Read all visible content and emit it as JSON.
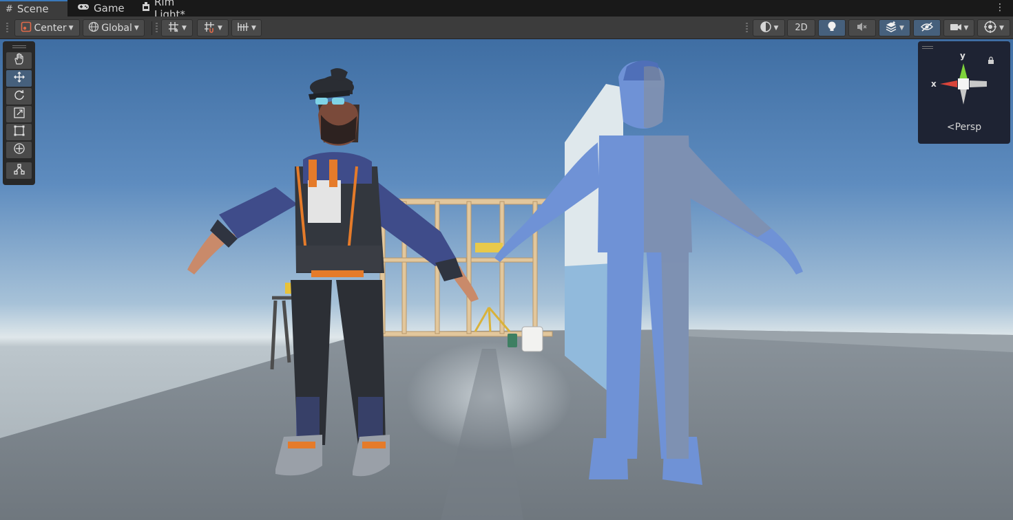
{
  "tabs": [
    {
      "label": "Scene",
      "icon": "hash-icon",
      "active": true
    },
    {
      "label": "Game",
      "icon": "gamepad-icon",
      "active": false
    },
    {
      "label": "Rim Light*",
      "icon": "prefab-icon",
      "active": false
    }
  ],
  "toolbar": {
    "pivot_label": "Center",
    "space_label": "Global",
    "toggle_2d_label": "2D",
    "icons": {
      "pivot": "pivot-center-icon",
      "space": "globe-icon",
      "grid": "grid-icon",
      "snap": "grid-snap-icon",
      "increment": "increment-snap-icon",
      "draw_mode": "shading-mode-icon",
      "lighting": "lightbulb-icon",
      "audio": "audio-mute-icon",
      "effects": "effects-layers-icon",
      "visibility": "hidden-eye-icon",
      "camera": "camera-icon",
      "gizmos": "gizmos-icon"
    }
  },
  "tools": [
    {
      "name": "hand-tool",
      "icon": "hand-icon",
      "selected": false
    },
    {
      "name": "move-tool",
      "icon": "move-arrows-icon",
      "selected": true
    },
    {
      "name": "rotate-tool",
      "icon": "rotate-icon",
      "selected": false
    },
    {
      "name": "scale-tool",
      "icon": "scale-icon",
      "selected": false
    },
    {
      "name": "rect-tool",
      "icon": "rect-transform-icon",
      "selected": false
    },
    {
      "name": "transform-tool",
      "icon": "transform-icon",
      "selected": false
    },
    {
      "name": "custom-tool",
      "icon": "custom-editor-tool-icon",
      "selected": false
    }
  ],
  "gizmo": {
    "projection_label": "Persp",
    "axis_x": "x",
    "axis_y": "y",
    "colors": {
      "x": "#d9443a",
      "y": "#7ed33b",
      "neutral": "#c8c8c8"
    }
  },
  "colors": {
    "accent": "#3a79bb",
    "selected_tool": "#46607c",
    "panel_bg": "#3c3c3c",
    "sky_top": "#3f6ea3",
    "ghost_character": "#6f92d6"
  }
}
